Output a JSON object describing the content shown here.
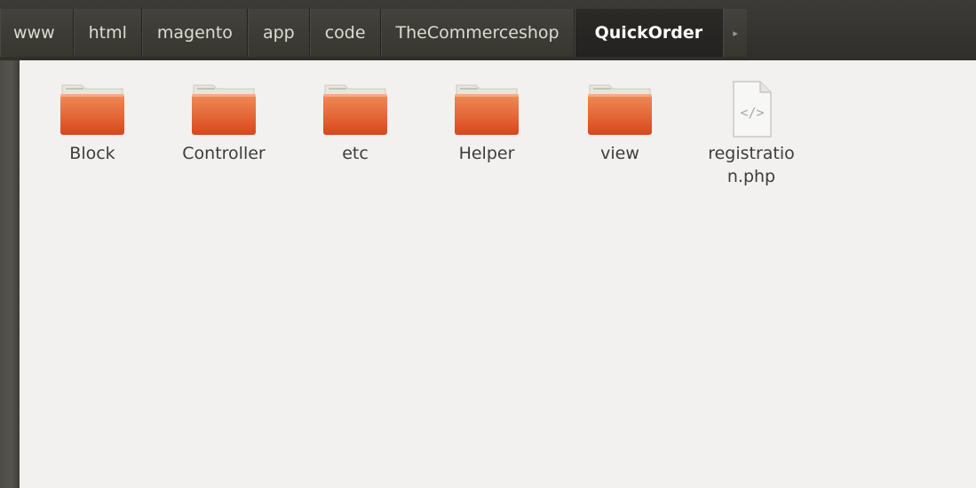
{
  "pathbar": {
    "crumbs": [
      {
        "label": "www"
      },
      {
        "label": "html"
      },
      {
        "label": "magento"
      },
      {
        "label": "app"
      },
      {
        "label": "code"
      },
      {
        "label": "TheCommerceshop"
      },
      {
        "label": "QuickOrder"
      }
    ],
    "arrow": "▸"
  },
  "files": {
    "items": [
      {
        "label": "Block",
        "type": "folder"
      },
      {
        "label": "Controller",
        "type": "folder"
      },
      {
        "label": "etc",
        "type": "folder"
      },
      {
        "label": "Helper",
        "type": "folder"
      },
      {
        "label": "view",
        "type": "folder"
      },
      {
        "label": "registratio n.php",
        "type": "php-file"
      }
    ]
  },
  "icons": {
    "folder": "folder-icon",
    "file": "php-file-icon",
    "forward": "chevron-right-icon"
  },
  "colors": {
    "folder_body": "#e2572a",
    "folder_top": "#f0a070",
    "pathbar_bg": "#3c3b37",
    "active_crumb_text": "#ffffff"
  }
}
